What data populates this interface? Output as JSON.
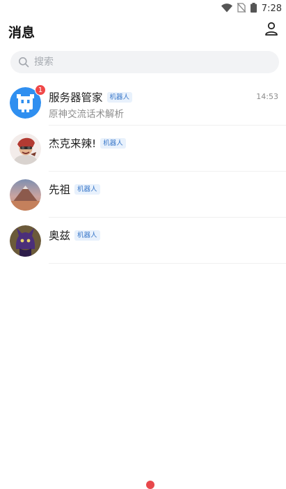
{
  "status_bar": {
    "time": "7:28",
    "icons": [
      "wifi-icon",
      "no-sim-icon",
      "battery-icon"
    ]
  },
  "header": {
    "title": "消息",
    "profile_icon": "user-icon"
  },
  "search": {
    "placeholder": "搜索",
    "value": "",
    "icon": "search-icon"
  },
  "conversations": [
    {
      "name": "服务器管家",
      "tag": "机器人",
      "time": "14:53",
      "preview": "原神交流话术解析",
      "badge": "1",
      "avatar": "robot-avatar"
    },
    {
      "name": "杰克来辣!",
      "tag": "机器人",
      "time": "",
      "preview": "",
      "badge": "",
      "avatar": "character-avatar"
    },
    {
      "name": "先祖",
      "tag": "机器人",
      "time": "",
      "preview": "",
      "badge": "",
      "avatar": "mountain-avatar"
    },
    {
      "name": "奥兹",
      "tag": "机器人",
      "time": "",
      "preview": "",
      "badge": "",
      "avatar": "creature-avatar"
    }
  ],
  "colors": {
    "accent_blue": "#2f8ff0",
    "badge_red": "#f04848",
    "tag_text": "#3a78c9",
    "tag_bg": "#e8f1fc"
  }
}
